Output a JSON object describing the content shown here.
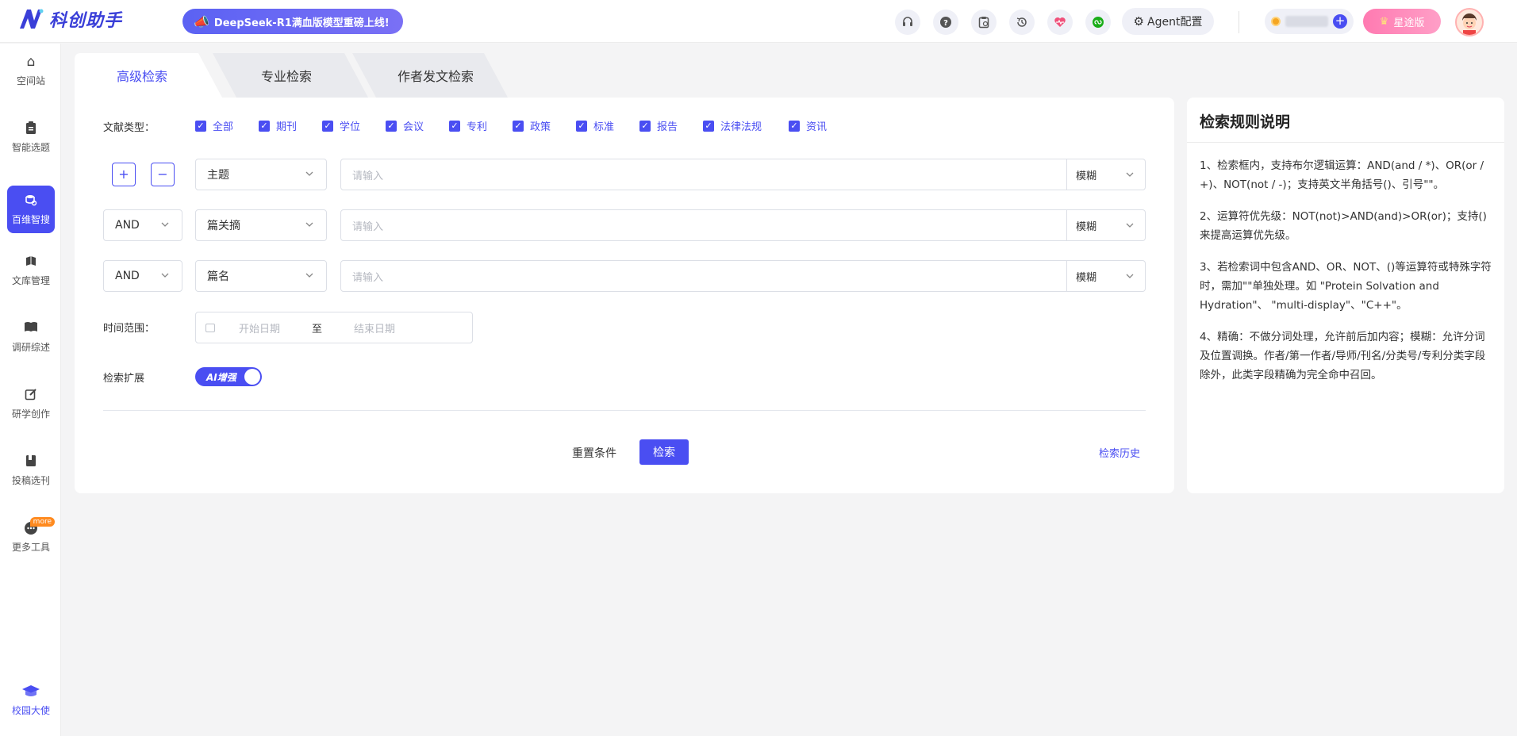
{
  "header": {
    "logo_text": "科创助手",
    "promo_text": "DeepSeek-R1满血版模型重磅上线!",
    "icons": [
      "headset-icon",
      "help-icon",
      "calendar-clipboard-icon",
      "history-icon",
      "heart-pulse-icon",
      "wechat-mini-icon"
    ],
    "agent_label": "Agent配置",
    "vip_label": "星途版"
  },
  "sidebar": {
    "items": [
      {
        "label": "空间站",
        "icon": "home-icon"
      },
      {
        "label": "智能选题",
        "icon": "clipboard-icon"
      },
      {
        "label": "百维智搜",
        "icon": "search-db-icon",
        "active": true
      },
      {
        "label": "文库管理",
        "icon": "books-icon"
      },
      {
        "label": "调研综述",
        "icon": "open-book-icon"
      },
      {
        "label": "研学创作",
        "icon": "edit-icon"
      },
      {
        "label": "投稿选刊",
        "icon": "journal-icon"
      },
      {
        "label": "更多工具",
        "icon": "chat-dots-icon",
        "badge": "more"
      }
    ],
    "campus_label": "校园大使"
  },
  "tabs": [
    {
      "label": "高级检索",
      "active": true
    },
    {
      "label": "专业检索"
    },
    {
      "label": "作者发文检索"
    }
  ],
  "form": {
    "doc_type_label": "文献类型：",
    "doc_types": [
      "全部",
      "期刊",
      "学位",
      "会议",
      "专利",
      "政策",
      "标准",
      "报告",
      "法律法规",
      "资讯"
    ],
    "rows": [
      {
        "logic": "",
        "field": "主题",
        "placeholder": "请输入",
        "mode": "模糊"
      },
      {
        "logic": "AND",
        "field": "篇关摘",
        "placeholder": "请输入",
        "mode": "模糊"
      },
      {
        "logic": "AND",
        "field": "篇名",
        "placeholder": "请输入",
        "mode": "模糊"
      }
    ],
    "add_symbol": "+",
    "remove_symbol": "−",
    "time_label": "时间范围：",
    "start_placeholder": "开始日期",
    "date_separator": "至",
    "end_placeholder": "结束日期",
    "expand_label": "检索扩展",
    "ai_toggle_label": "AI增强",
    "ai_toggle_on": true,
    "reset_label": "重置条件",
    "search_label": "检索",
    "history_label": "检索历史"
  },
  "rules": {
    "title": "检索规则说明",
    "paragraphs": [
      "1、检索框内，支持布尔逻辑运算：AND(and / *)、OR(or / +)、NOT(not / -)；支持英文半角括号()、引号\"\"。",
      "2、运算符优先级：NOT(not)>AND(and)>OR(or)；支持()来提高运算优先级。",
      "3、若检索词中包含AND、OR、NOT、()等运算符或特殊字符时，需加\"\"单独处理。如 \"Protein Solvation and Hydration\"、 \"multi-display\"、\"C++\"。",
      "4、精确：不做分词处理，允许前后加内容；模糊：允许分词及位置调换。作者/第一作者/导师/刊名/分类号/专利分类字段除外，此类字段精确为完全命中召回。"
    ]
  },
  "colors": {
    "accent": "#4a4ef2",
    "vip": "#ff86b8",
    "more_badge": "#ff8a1f"
  }
}
